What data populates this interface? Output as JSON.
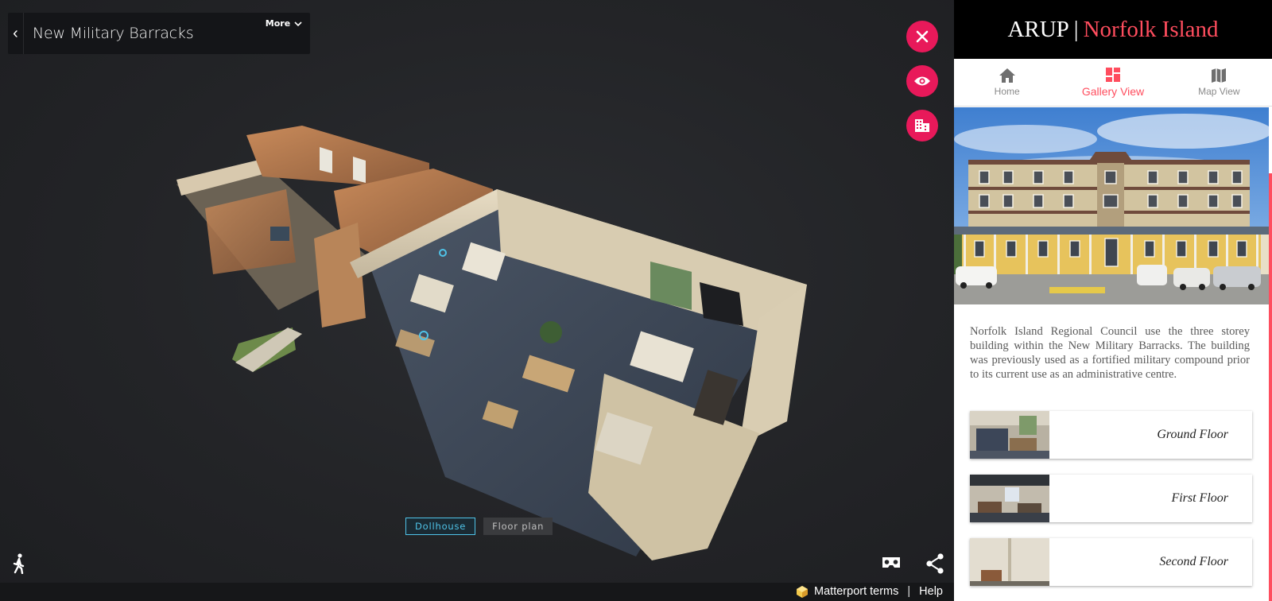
{
  "viewer": {
    "title": "New Military Barracks",
    "more_label": "More",
    "modes": {
      "dollhouse": "Dollhouse",
      "floorplan": "Floor plan"
    },
    "footer": {
      "terms": "Matterport terms",
      "separator": "|",
      "help": "Help"
    },
    "buttons": [
      "close-icon",
      "eye-icon",
      "building-icon"
    ],
    "accent_color": "#e8195a",
    "active_mode_color": "#4fc3e8"
  },
  "panel": {
    "brand": {
      "company": "ARUP",
      "separator": "|",
      "place": "Norfolk Island"
    },
    "nav": [
      {
        "label": "Home",
        "icon": "home-icon"
      },
      {
        "label": "Gallery View",
        "icon": "gallery-icon",
        "active": true
      },
      {
        "label": "Map View",
        "icon": "map-icon"
      }
    ],
    "description": "Norfolk Island Regional Council use the three storey building within the New Military Barracks. The building was previously used as a fortified military compound prior to its current use as an administrative centre.",
    "floors": [
      "Ground Floor",
      "First Floor",
      "Second Floor"
    ],
    "accent_color": "#ff4d5e"
  }
}
